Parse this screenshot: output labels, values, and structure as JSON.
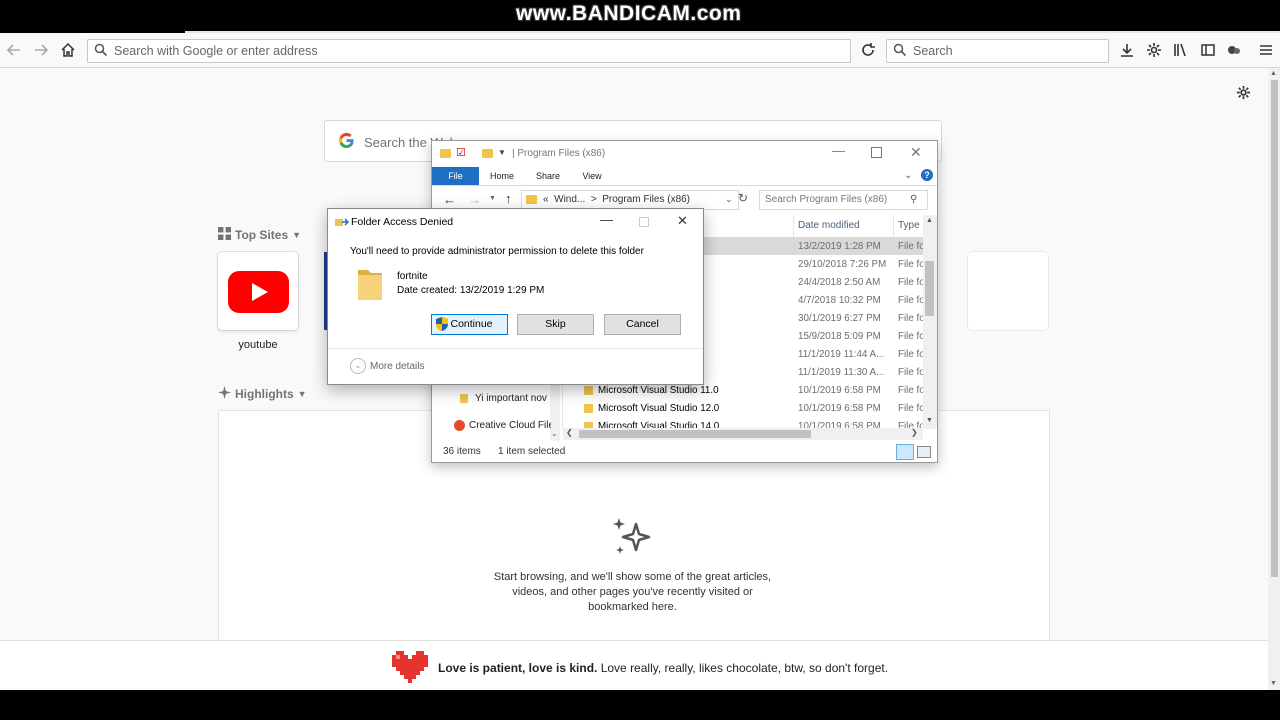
{
  "watermark": "www.BANDICAM.com",
  "browser": {
    "url_placeholder": "Search with Google or enter address",
    "search_placeholder": "Search"
  },
  "newtab": {
    "web_search_placeholder": "Search the Web",
    "top_sites_label": "Top Sites",
    "top_sites": [
      {
        "label": "youtube"
      }
    ],
    "highlights_label": "Highlights",
    "highlights_empty_line1": "Start browsing, and we'll show some of the great articles,",
    "highlights_empty_line2": "videos, and other pages you've recently visited or",
    "highlights_empty_line3": "bookmarked here.",
    "footer_bold": "Love is patient, love is kind.",
    "footer_text": " Love really, really, likes chocolate, btw, so don't forget."
  },
  "explorer": {
    "title": "Program Files (x86)",
    "tabs": {
      "file": "File",
      "home": "Home",
      "share": "Share",
      "view": "View"
    },
    "breadcrumb": {
      "prefix": "«",
      "part1": "Wind...",
      "sep": ">",
      "part2": "Program Files (x86)"
    },
    "search_placeholder": "Search Program Files (x86)",
    "columns": {
      "date": "Date modified",
      "type": "Type"
    },
    "rows": [
      {
        "name": "",
        "date": "13/2/2019 1:28 PM",
        "type": "File fo"
      },
      {
        "name": "",
        "date": "29/10/2018 7:26 PM",
        "type": "File fo"
      },
      {
        "name": "",
        "date": "24/4/2018 2:50 AM",
        "type": "File fo"
      },
      {
        "name": "",
        "date": "4/7/2018 10:32 PM",
        "type": "File fo"
      },
      {
        "name": "",
        "date": "30/1/2019 6:27 PM",
        "type": "File fo"
      },
      {
        "name": "",
        "date": "15/9/2018 5:09 PM",
        "type": "File fo"
      },
      {
        "name": "",
        "date": "11/1/2019 11:44 A...",
        "type": "File fo"
      },
      {
        "name": "",
        "date": "11/1/2019 11:30 A...",
        "type": "File fo"
      },
      {
        "name": "Microsoft Visual Studio 11.0",
        "date": "10/1/2019 6:58 PM",
        "type": "File fo"
      },
      {
        "name": "Microsoft Visual Studio 12.0",
        "date": "10/1/2019 6:58 PM",
        "type": "File fo"
      },
      {
        "name": "Microsoft Visual Studio 14.0",
        "date": "10/1/2019 6:58 PM",
        "type": "File fo"
      }
    ],
    "nav_items": [
      "Yi important nov",
      "Creative Cloud File"
    ],
    "status_items": "36 items",
    "status_selected": "1 item selected"
  },
  "dialog": {
    "title": "Folder Access Denied",
    "message": "You'll need to provide administrator permission to delete this folder",
    "folder_name": "fortnite",
    "date_created": "Date created: 13/2/2019 1:29 PM",
    "continue_label": "Continue",
    "skip_label": "Skip",
    "cancel_label": "Cancel",
    "more_details": "More details"
  },
  "colors": {
    "ribbon_file": "#1e6fc4",
    "youtube_red": "#ff0000",
    "heart": "#e3342f",
    "selected_row": "#cce8ff"
  }
}
